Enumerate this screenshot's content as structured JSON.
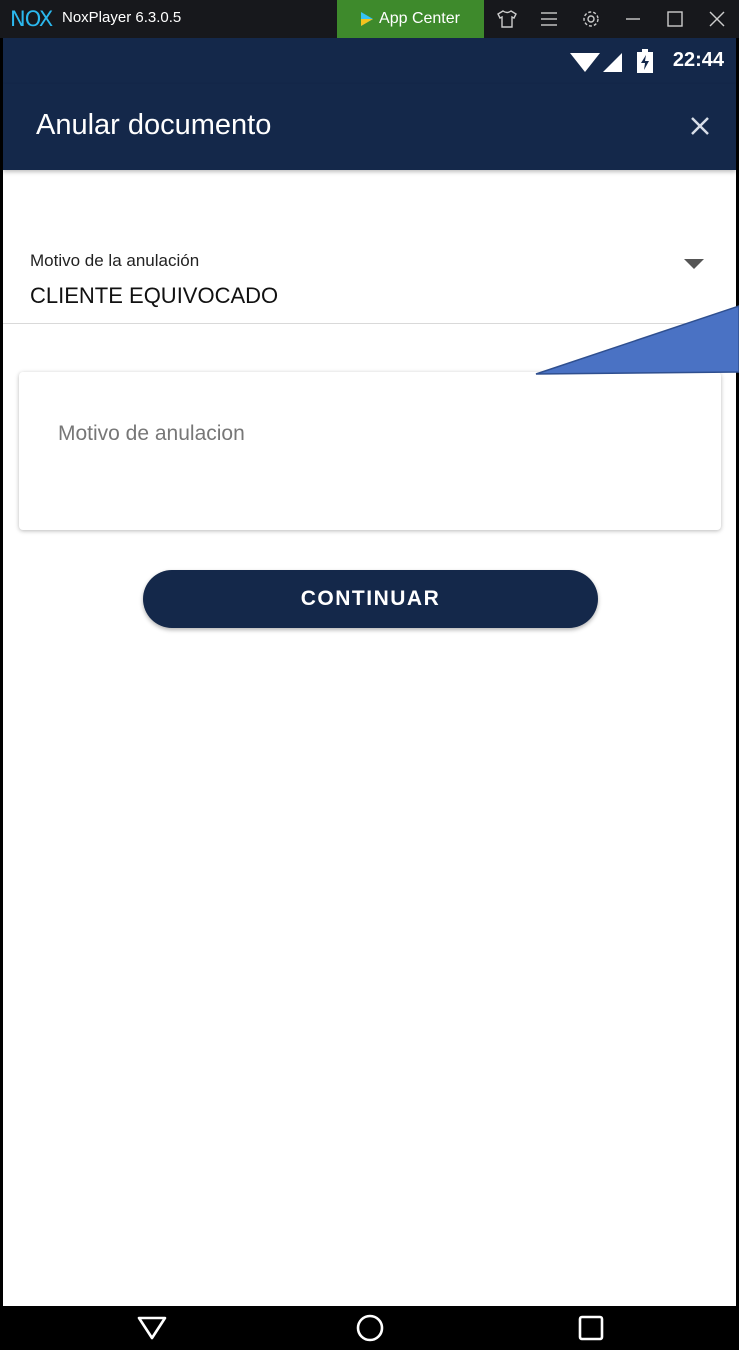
{
  "emulator": {
    "title": "NoxPlayer 6.3.0.5",
    "logo_text": "NOX",
    "app_center_label": "App Center",
    "icons": [
      "shirt-icon",
      "menu-icon",
      "settings-icon",
      "minimize-icon",
      "maximize-icon",
      "close-window-icon"
    ]
  },
  "status_bar": {
    "time": "22:44",
    "icons": [
      "wifi-icon",
      "signal-icon",
      "battery-charging-icon"
    ]
  },
  "app_bar": {
    "title": "Anular documento",
    "close_icon": "close-icon"
  },
  "form": {
    "reason_select": {
      "label": "Motivo de la anulación",
      "value": "CLIENTE EQUIVOCADO"
    },
    "reason_text": {
      "placeholder": "Motivo de anulacion",
      "value": ""
    },
    "continue_label": "CONTINUAR"
  },
  "nav_bar": {
    "buttons": [
      "back-icon",
      "home-icon",
      "recents-icon"
    ]
  },
  "colors": {
    "primary": "#14284a",
    "app_center": "#3e8a2c",
    "nox_blue": "#2bb8ee",
    "callout_fill": "#4a72c4",
    "callout_stroke": "#2f4f8f"
  }
}
